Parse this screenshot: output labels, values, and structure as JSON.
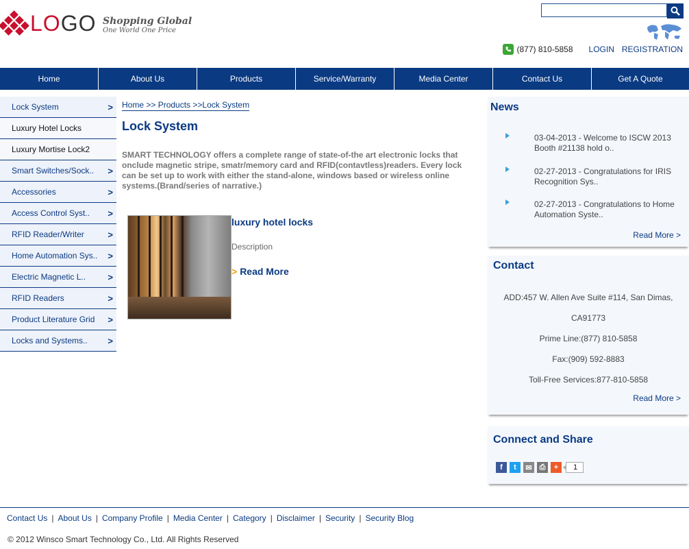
{
  "header": {
    "logo_text_red": "LO",
    "logo_text_dark": "GO",
    "tagline_main": "Shopping Global",
    "tagline_sub": "One World One Price",
    "search_placeholder": "",
    "phone": "(877) 810-5858",
    "login": "LOGIN",
    "registration": "REGISTRATION"
  },
  "nav": {
    "items": [
      {
        "label": "Home"
      },
      {
        "label": "About Us"
      },
      {
        "label": "Products"
      },
      {
        "label": "Service/Warranty"
      },
      {
        "label": "Media Center"
      },
      {
        "label": "Contact Us"
      },
      {
        "label": "Get A Quote"
      }
    ]
  },
  "sidebar": {
    "chevron": ">",
    "items": [
      {
        "label": "Lock System"
      },
      {
        "label": "Luxury Hotel Locks"
      },
      {
        "label": "Luxury Mortise Lock2"
      },
      {
        "label": "Smart Switches/Sock.."
      },
      {
        "label": "Accessories"
      },
      {
        "label": "Access Control Syst.."
      },
      {
        "label": "RFID Reader/Writer"
      },
      {
        "label": "Home Automation Sys.."
      },
      {
        "label": "Electric Magnetic L.."
      },
      {
        "label": "RFID Readers"
      },
      {
        "label": "Product Literature Grid"
      },
      {
        "label": "Locks and Systems.."
      }
    ]
  },
  "main": {
    "breadcrumb": "Home >> Products >>Lock System",
    "title": "Lock System",
    "intro": "SMART TECHNOLOGY offers a complete range of state-of-the art electronic locks that onclude magnetic stripe, smatr/memory card and RFID(contavtless)readers. Every lock can be set up to work with either the stand-alone, windows based or wireless online systems.(Brand/series of narrative.)",
    "product": {
      "name": "luxury hotel locks",
      "description": "Description",
      "read_more_arrow": ">",
      "read_more": "Read More"
    }
  },
  "news": {
    "title": "News",
    "items": [
      {
        "text": "03-04-2013 - Welcome to ISCW 2013 Booth #21138 hold o.."
      },
      {
        "text": "02-27-2013 - Congratulations for IRIS Recognition Sys.."
      },
      {
        "text": "02-27-2013 - Congratulations to Home Automation Syste.."
      }
    ],
    "more": "Read More >"
  },
  "contact": {
    "title": "Contact",
    "address_1": "ADD:457 W. Allen Ave Suite #114, San Dimas,",
    "address_2": "CA91773",
    "prime_line": "Prime Line:(877) 810-5858",
    "fax": "Fax:(909) 592-8883",
    "toll_free": "Toll-Free Services:877-810-5858",
    "more": "Read More >"
  },
  "connect": {
    "title": "Connect and Share",
    "count": "1",
    "icons": [
      "facebook-icon",
      "twitter-icon",
      "email-icon",
      "print-icon",
      "more-share-icon"
    ],
    "colors": {
      "facebook": "#3b5998",
      "twitter": "#1da1f2",
      "email": "#888888",
      "print": "#777777",
      "more": "#f05a28"
    }
  },
  "footer": {
    "links": [
      {
        "label": "Contact Us"
      },
      {
        "label": "About Us"
      },
      {
        "label": "Company Profile"
      },
      {
        "label": "Media Center"
      },
      {
        "label": "Category"
      },
      {
        "label": "Disclaimer"
      },
      {
        "label": "Security"
      },
      {
        "label": "Security Blog"
      }
    ],
    "separator": "|",
    "copyright": "© 2012 Winsco Smart Technology Co., Ltd. All Rights Reserved"
  },
  "colors": {
    "brand_blue": "#0a3a82",
    "logo_red": "#c8102e",
    "accent_orange": "#f0a000"
  }
}
